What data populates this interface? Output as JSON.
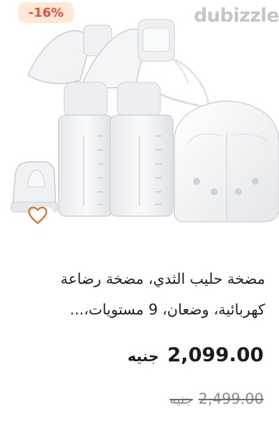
{
  "product": {
    "discount_badge": "-16%",
    "watermark": "dubizzle",
    "title_line1": "مضخة حليب الثدي، مضخة رضاعة",
    "title_line2": "كهربائية، وضعان، 9 مستويات،...",
    "price_value": "2,099.00",
    "price_currency": "جنيه",
    "old_price_value": "2,499.00",
    "old_price_currency": "جنيه"
  },
  "icons": {
    "favorite": "heart-outline-icon"
  },
  "colors": {
    "badge_background": "#fde9d6",
    "badge_text": "#ef4b3f",
    "watermark": "#c5c5c5",
    "heart": "#e46a2b"
  }
}
